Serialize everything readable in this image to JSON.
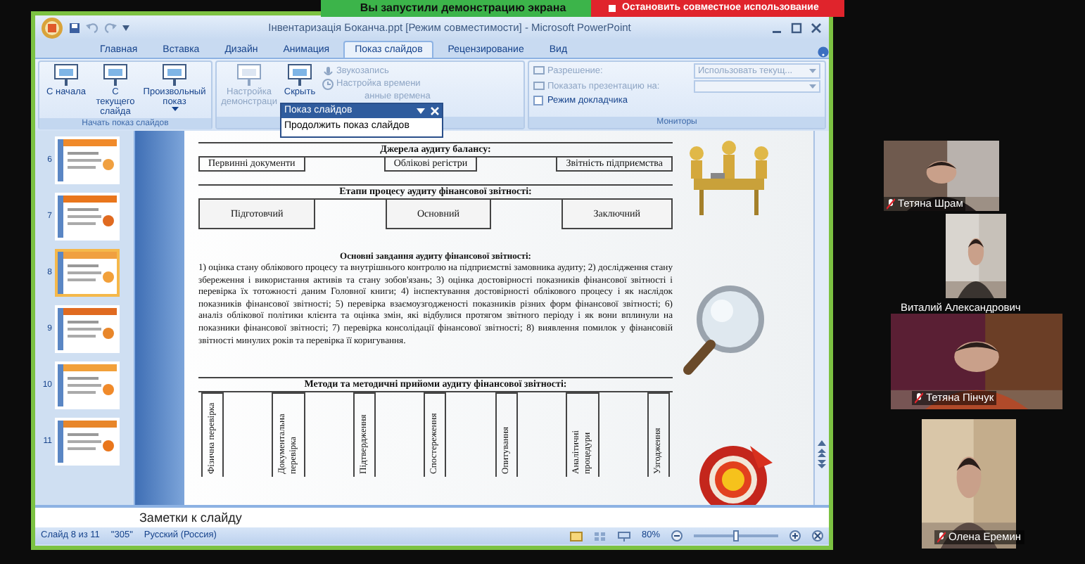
{
  "share_bar": {
    "status": "Вы запустили демонстрацию экрана",
    "stop_button": "Остановить совместное использование"
  },
  "window": {
    "title": "Інвентаризація Боканча.ppt [Режим совместимости] - Microsoft PowerPoint"
  },
  "tabs": [
    {
      "label": "Главная",
      "selected": false
    },
    {
      "label": "Вставка",
      "selected": false
    },
    {
      "label": "Дизайн",
      "selected": false
    },
    {
      "label": "Анимация",
      "selected": false
    },
    {
      "label": "Показ слайдов",
      "selected": true
    },
    {
      "label": "Рецензирование",
      "selected": false
    },
    {
      "label": "Вид",
      "selected": false
    }
  ],
  "start_group": {
    "label": "Начать показ слайдов",
    "buttons": [
      "С начала",
      "С текущего слайда",
      "Произвольный показ"
    ]
  },
  "setup_group": {
    "large": [
      {
        "label": "Настройка демонстраци",
        "disabled": true
      },
      {
        "label": "Скрыть",
        "disabled": false
      }
    ],
    "small": [
      {
        "label": "Звукозапись",
        "disabled": true
      },
      {
        "label": "Настройка времени",
        "disabled": true
      },
      {
        "label": "анные времена",
        "disabled": true
      }
    ]
  },
  "monitors_group": {
    "label": "Мониторы",
    "resolution_label": "Разрешение:",
    "resolution_value": "Использовать текущ...",
    "show_on_label": "Показать презентацию на:",
    "presenter_mode": {
      "label": "Режим докладчика",
      "checked": false
    }
  },
  "floating_toolbar": {
    "title": "Показ слайдов",
    "item": "Продолжить показ слайдов"
  },
  "slide_thumbnails": [
    {
      "number": "6",
      "selected": false
    },
    {
      "number": "7",
      "selected": false
    },
    {
      "number": "8",
      "selected": true
    },
    {
      "number": "9",
      "selected": false
    },
    {
      "number": "10",
      "selected": false
    },
    {
      "number": "11",
      "selected": false
    }
  ],
  "slide": {
    "sources": {
      "heading": "Джерела аудиту балансу:",
      "items": [
        "Первинні документи",
        "Облікові регістри",
        "Звітність підприємства"
      ]
    },
    "stages": {
      "heading": "Етапи процесу аудиту фінансової звітності:",
      "items": [
        "Підготовчий",
        "Основний",
        "Заключний"
      ]
    },
    "tasks": {
      "heading": "Основні завдання аудиту фінансової звітності:",
      "text": "1) оцінка стану облікового процесу та внутрішнього контролю на підприємстві замовника аудиту; 2) дослідження стану збереження і використання активів та стану зобов'язань; 3) оцінка достовірності показників фінансової звітності і перевірка їх тотожності даним Головної книги; 4) інспектування достовірності облікового процесу і як наслідок показників фінансової звітності; 5) перевірка взаємоузгодженості показників різних форм фінансової звітності; 6) аналіз облікової політики клієнта та оцінка змін, які відбулися протягом звітного періоду і як вони вплинули на показники фінансової звітності; 7) перевірка консолідації фінансової звітності; 8) виявлення помилок у фінансовій звітності минулих років та перевірка її коригування."
    },
    "methods": {
      "heading": "Методи та методичні прийоми аудиту фінансової звітності:",
      "items": [
        "Фізична перевірка",
        "Документальна перевірка",
        "Підтвердження",
        "Спостереження",
        "Опитування",
        "Аналітичні процедури",
        "Узгодження"
      ]
    }
  },
  "notes_placeholder": "Заметки к слайду",
  "status_bar": {
    "slide": "Слайд 8 из 11",
    "theme": "\"305\"",
    "language": "Русский (Россия)",
    "zoom": "80%",
    "zoom_slider": {
      "level": 0.5
    }
  },
  "participants": [
    {
      "name": "Тетяна Шрам",
      "muted": true
    },
    {
      "name": "Виталий Александрович",
      "muted": false
    },
    {
      "name": "Тетяна Пінчук",
      "muted": true
    },
    {
      "name": "Олена Еремин",
      "muted": true
    }
  ]
}
